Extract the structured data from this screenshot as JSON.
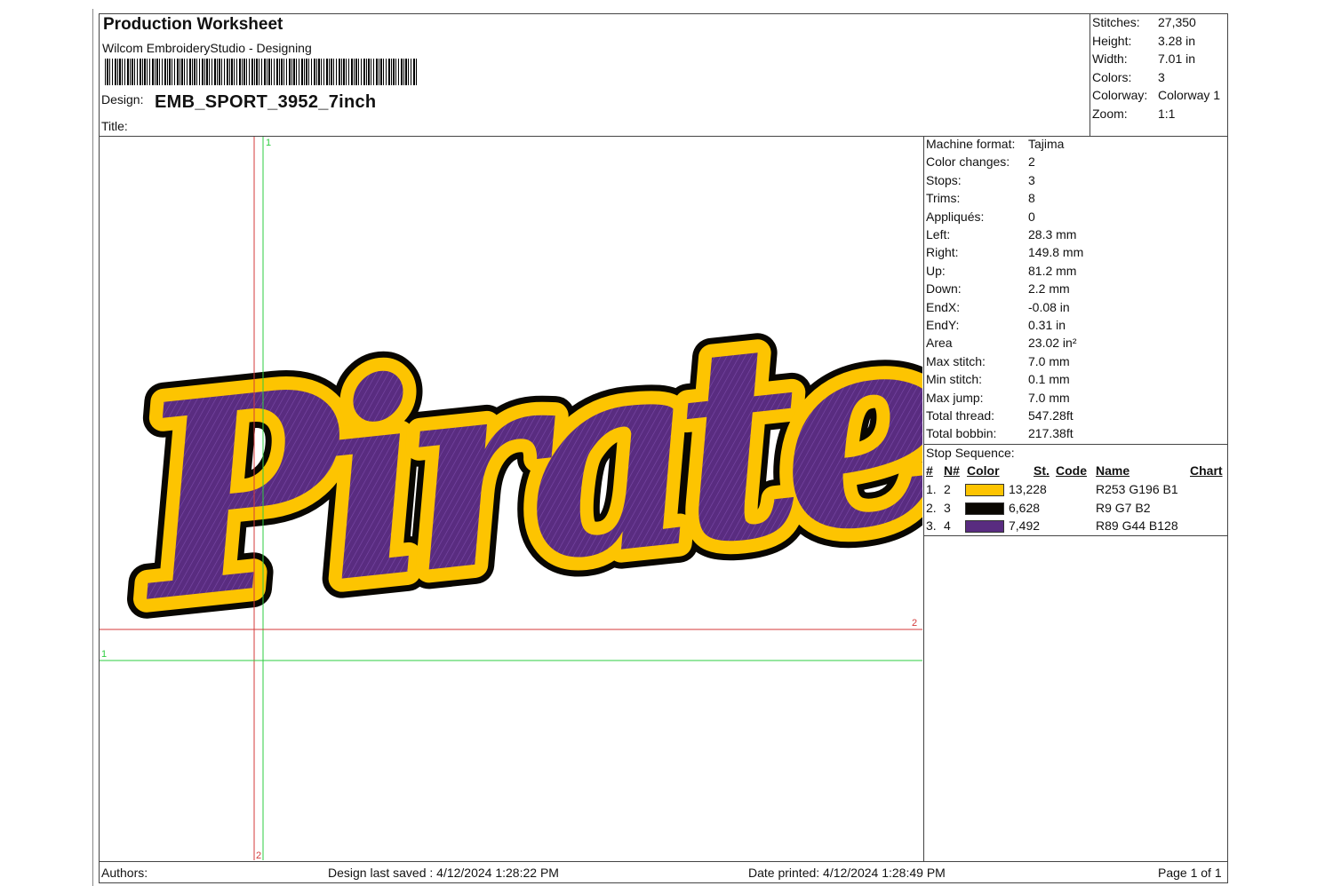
{
  "header": {
    "title": "Production Worksheet",
    "software": "Wilcom EmbroideryStudio - Designing",
    "design_label": "Design:",
    "design_value": "EMB_SPORT_3952_7inch",
    "title_label": "Title:"
  },
  "summary": [
    {
      "label": "Stitches:",
      "value": "27,350"
    },
    {
      "label": "Height:",
      "value": "3.28 in"
    },
    {
      "label": "Width:",
      "value": "7.01 in"
    },
    {
      "label": "Colors:",
      "value": "3"
    },
    {
      "label": "Colorway:",
      "value": "Colorway 1"
    },
    {
      "label": "Zoom:",
      "value": "1:1"
    }
  ],
  "machine_info": [
    {
      "label": "Machine format:",
      "value": "Tajima"
    },
    {
      "label": "Color changes:",
      "value": "2"
    },
    {
      "label": "Stops:",
      "value": "3"
    },
    {
      "label": "Trims:",
      "value": "8"
    },
    {
      "label": "Appliqués:",
      "value": "0"
    },
    {
      "label": "Left:",
      "value": "28.3 mm"
    },
    {
      "label": "Right:",
      "value": "149.8 mm"
    },
    {
      "label": "Up:",
      "value": "81.2 mm"
    },
    {
      "label": "Down:",
      "value": "2.2 mm"
    },
    {
      "label": "EndX:",
      "value": "-0.08 in"
    },
    {
      "label": "EndY:",
      "value": "0.31 in"
    },
    {
      "label": "Area",
      "value": "23.02 in²"
    },
    {
      "label": "Max stitch:",
      "value": "7.0 mm"
    },
    {
      "label": "Min stitch:",
      "value": "0.1 mm"
    },
    {
      "label": "Max jump:",
      "value": "7.0 mm"
    },
    {
      "label": "Total thread:",
      "value": "547.28ft"
    },
    {
      "label": "Total bobbin:",
      "value": "217.38ft"
    }
  ],
  "stop_sequence": {
    "title": "Stop Sequence:",
    "headers": {
      "num": "#",
      "needle": "N#",
      "color": "Color",
      "stitches": "St.",
      "code": "Code",
      "name": "Name",
      "chart": "Chart"
    },
    "rows": [
      {
        "num": "1.",
        "needle": "2",
        "swatch": "#FDC401",
        "stitches": "13,228",
        "name": "R253 G196 B1"
      },
      {
        "num": "2.",
        "needle": "3",
        "swatch": "#090702",
        "stitches": "6,628",
        "name": "R9 G7 B2"
      },
      {
        "num": "3.",
        "needle": "4",
        "swatch": "#592C80",
        "stitches": "7,492",
        "name": "R89 G44 B128"
      }
    ]
  },
  "canvas": {
    "design_text": "Pirates",
    "guide_labels": {
      "top_green": "1",
      "left_green": "1",
      "right_red": "2",
      "bottom_red": "2"
    },
    "colors": {
      "gold": "#FDC401",
      "black": "#090702",
      "purple": "#592C80",
      "guide_red": "#d43a3a",
      "guide_green": "#2ecc40"
    }
  },
  "footer": {
    "authors": "Authors:",
    "saved": "Design last saved : 4/12/2024 1:28:22 PM",
    "printed": "Date printed: 4/12/2024 1:28:49 PM",
    "page": "Page 1 of 1"
  }
}
